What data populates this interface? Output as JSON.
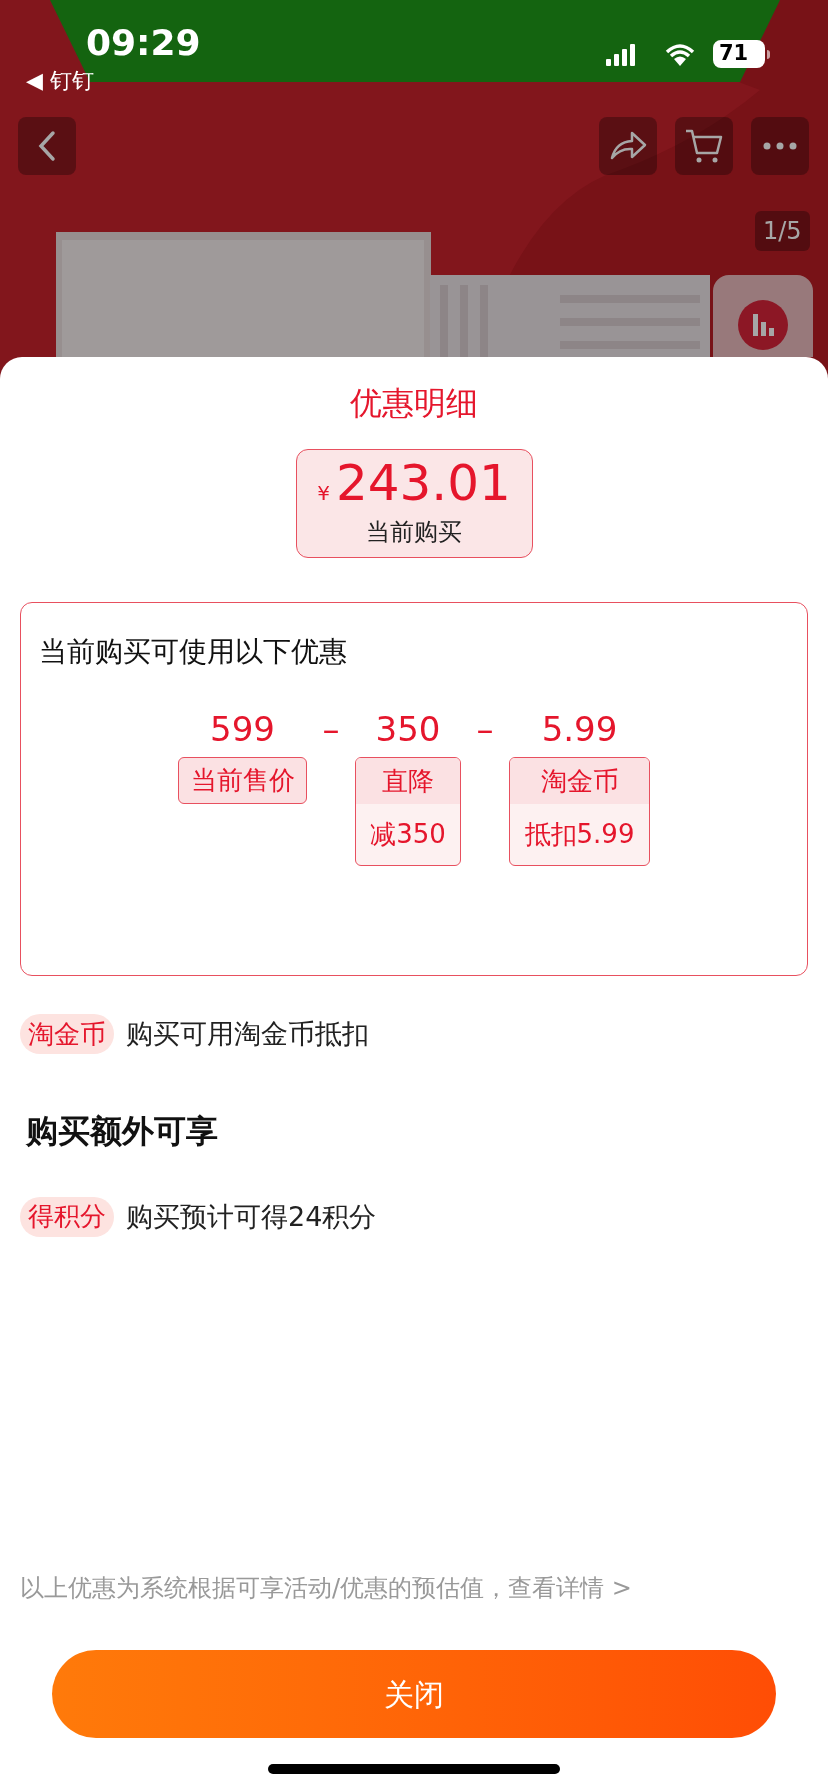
{
  "status_bar": {
    "time": "09:29",
    "back_app": "◀ 钉钉",
    "battery": "71"
  },
  "product_page": {
    "image_counter": "1/5"
  },
  "sheet": {
    "title": "优惠明细",
    "price": {
      "currency": "¥",
      "amount": "243.01",
      "label": "当前购买"
    },
    "breakdown": {
      "heading": "当前购买可使用以下优惠",
      "items": [
        {
          "kind": "base",
          "value": "599",
          "tag": "当前售价"
        },
        {
          "kind": "discount",
          "operator": "–",
          "value": "350",
          "tag": "直降",
          "detail": "减350"
        },
        {
          "kind": "discount",
          "operator": "–",
          "value": "5.99",
          "tag": "淘金币",
          "detail": "抵扣5.99"
        }
      ]
    },
    "benefits": [
      {
        "badge": "淘金币",
        "text": "购买可用淘金币抵扣"
      }
    ],
    "extras_heading": "购买额外可享",
    "extras": [
      {
        "badge": "得积分",
        "text": "购买预计可得24积分"
      }
    ],
    "footnote": "以上优惠为系统根据可享活动/优惠的预估值，查看详情 >",
    "close_button": "关闭"
  }
}
